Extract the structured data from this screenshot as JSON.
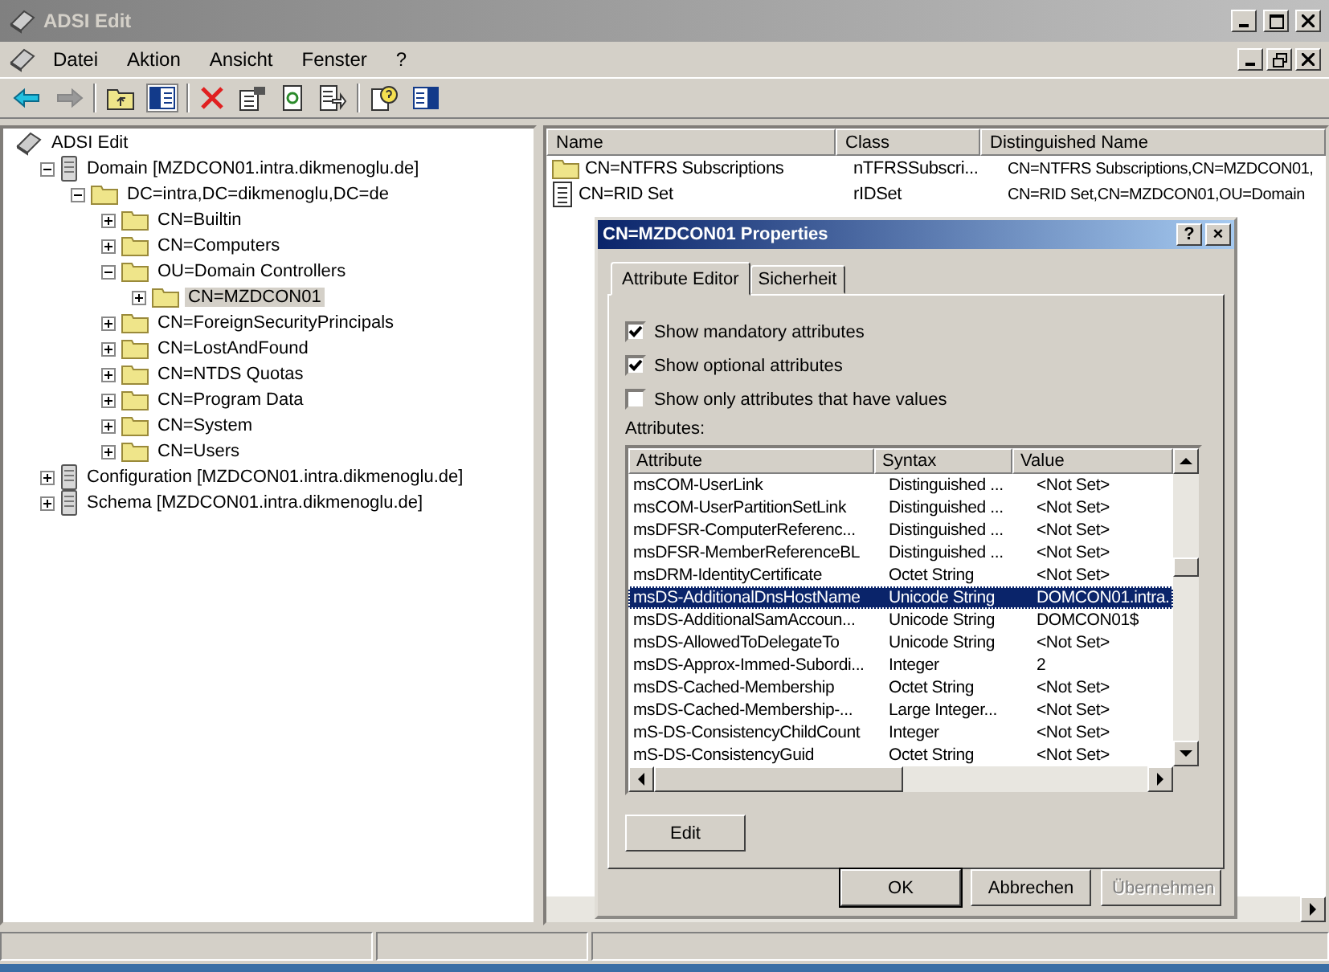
{
  "window": {
    "title": "ADSI Edit"
  },
  "menu": [
    "Datei",
    "Aktion",
    "Ansicht",
    "Fenster",
    "?"
  ],
  "toolbar": [
    {
      "kind": "back",
      "disabled": false
    },
    {
      "kind": "forward",
      "disabled": true
    },
    {
      "kind": "sep"
    },
    {
      "kind": "up",
      "disabled": false
    },
    {
      "kind": "tree",
      "disabled": false
    },
    {
      "kind": "sep"
    },
    {
      "kind": "delete",
      "disabled": false
    },
    {
      "kind": "properties",
      "disabled": false
    },
    {
      "kind": "refresh",
      "disabled": false
    },
    {
      "kind": "export",
      "disabled": false
    },
    {
      "kind": "sep"
    },
    {
      "kind": "help",
      "disabled": false
    },
    {
      "kind": "panel",
      "disabled": false
    }
  ],
  "tree": [
    {
      "label": "ADSI Edit",
      "kind": "snapin",
      "selected": false,
      "children": [
        {
          "label": "Domain [MZDCON01.intra.dikmenoglu.de]",
          "kind": "server",
          "expanded": true,
          "selected": false,
          "children": [
            {
              "label": "DC=intra,DC=dikmenoglu,DC=de",
              "kind": "folder",
              "expanded": true,
              "selected": false,
              "children": [
                {
                  "label": "CN=Builtin",
                  "kind": "folder",
                  "expanded": false,
                  "selected": false
                },
                {
                  "label": "CN=Computers",
                  "kind": "folder",
                  "expanded": false,
                  "selected": false
                },
                {
                  "label": "OU=Domain Controllers",
                  "kind": "folder",
                  "expanded": true,
                  "selected": false,
                  "children": [
                    {
                      "label": "CN=MZDCON01",
                      "kind": "folder",
                      "expanded": false,
                      "selected": true
                    }
                  ]
                },
                {
                  "label": "CN=ForeignSecurityPrincipals",
                  "kind": "folder",
                  "expanded": false,
                  "selected": false
                },
                {
                  "label": "CN=LostAndFound",
                  "kind": "folder",
                  "expanded": false,
                  "selected": false
                },
                {
                  "label": "CN=NTDS Quotas",
                  "kind": "folder",
                  "expanded": false,
                  "selected": false
                },
                {
                  "label": "CN=Program Data",
                  "kind": "folder",
                  "expanded": false,
                  "selected": false
                },
                {
                  "label": "CN=System",
                  "kind": "folder",
                  "expanded": false,
                  "selected": false
                },
                {
                  "label": "CN=Users",
                  "kind": "folder",
                  "expanded": false,
                  "selected": false
                }
              ]
            }
          ]
        },
        {
          "label": "Configuration [MZDCON01.intra.dikmenoglu.de]",
          "kind": "server",
          "expanded": false,
          "selected": false
        },
        {
          "label": "Schema [MZDCON01.intra.dikmenoglu.de]",
          "kind": "server",
          "expanded": false,
          "selected": false
        }
      ]
    }
  ],
  "list": {
    "columns": [
      "Name",
      "Class",
      "Distinguished Name"
    ],
    "rows": [
      {
        "kind": "folder",
        "cells": [
          "CN=NTFRS Subscriptions",
          "nTFRSSubscri...",
          "CN=NTFRS Subscriptions,CN=MZDCON01,"
        ]
      },
      {
        "kind": "document",
        "cells": [
          "CN=RID Set",
          "rIDSet",
          "CN=RID Set,CN=MZDCON01,OU=Domain"
        ]
      }
    ]
  },
  "dialog": {
    "title": "CN=MZDCON01 Properties",
    "title_buttons": [
      "?",
      "×"
    ],
    "tabs": [
      {
        "label": "Attribute Editor",
        "selected": true
      },
      {
        "label": "Sicherheit",
        "selected": false
      }
    ],
    "checkboxes": [
      {
        "label": "Show mandatory attributes",
        "checked": true
      },
      {
        "label": "Show optional attributes",
        "checked": true
      },
      {
        "label": "Show only attributes that have values",
        "checked": false
      }
    ],
    "attributes_label": "Attributes:",
    "table": {
      "columns": [
        "Attribute",
        "Syntax",
        "Value"
      ],
      "rows": [
        {
          "cells": [
            "msCOM-UserLink",
            "Distinguished ...",
            "<Not Set>"
          ],
          "selected": false
        },
        {
          "cells": [
            "msCOM-UserPartitionSetLink",
            "Distinguished ...",
            "<Not Set>"
          ],
          "selected": false
        },
        {
          "cells": [
            "msDFSR-ComputerReferenc...",
            "Distinguished ...",
            "<Not Set>"
          ],
          "selected": false
        },
        {
          "cells": [
            "msDFSR-MemberReferenceBL",
            "Distinguished ...",
            "<Not Set>"
          ],
          "selected": false
        },
        {
          "cells": [
            "msDRM-IdentityCertificate",
            "Octet String",
            "<Not Set>"
          ],
          "selected": false
        },
        {
          "cells": [
            "msDS-AdditionalDnsHostName",
            "Unicode String",
            "DOMCON01.intra."
          ],
          "selected": true
        },
        {
          "cells": [
            "msDS-AdditionalSamAccoun...",
            "Unicode String",
            "DOMCON01$"
          ],
          "selected": false
        },
        {
          "cells": [
            "msDS-AllowedToDelegateTo",
            "Unicode String",
            "<Not Set>"
          ],
          "selected": false
        },
        {
          "cells": [
            "msDS-Approx-Immed-Subordi...",
            "Integer",
            "2"
          ],
          "selected": false
        },
        {
          "cells": [
            "msDS-Cached-Membership",
            "Octet String",
            "<Not Set>"
          ],
          "selected": false
        },
        {
          "cells": [
            "msDS-Cached-Membership-...",
            "Large Integer...",
            "<Not Set>"
          ],
          "selected": false
        },
        {
          "cells": [
            "mS-DS-ConsistencyChildCount",
            "Integer",
            "<Not Set>"
          ],
          "selected": false
        },
        {
          "cells": [
            "mS-DS-ConsistencyGuid",
            "Octet String",
            "<Not Set>"
          ],
          "selected": false
        }
      ]
    },
    "edit_button": "Edit",
    "buttons": [
      {
        "label": "OK",
        "default": true,
        "disabled": false
      },
      {
        "label": "Abbrechen",
        "default": false,
        "disabled": false
      },
      {
        "label": "Übernehmen",
        "default": false,
        "disabled": true
      }
    ]
  }
}
